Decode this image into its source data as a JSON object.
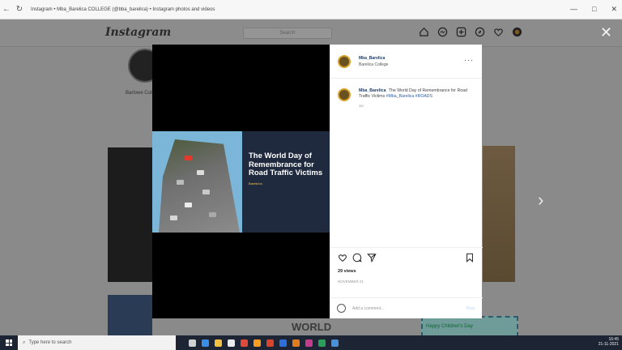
{
  "browser": {
    "title": "Instagram • Mba_Barelica COLLEGE (@bba_barelica) • Instagram photos and videos",
    "back_icon": "back-arrow-icon",
    "reload_icon": "reload-icon",
    "window_controls": [
      "—",
      "□",
      "✕"
    ]
  },
  "instagram": {
    "logo_text": "Instagram",
    "search_placeholder": "Search",
    "nav_icons": [
      "home-icon",
      "messenger-icon",
      "new-post-icon",
      "explore-icon",
      "heart-icon",
      "profile-avatar-icon"
    ],
    "close_label": "✕",
    "next_label": "›"
  },
  "background": {
    "profile_name": "Barlowe College",
    "bottom_text": "WORLD",
    "kids_banner": "Happy Children's Day"
  },
  "post": {
    "image_headline": "The World Day of Remembrance for Road Traffic Victims",
    "image_small": "Barelicha",
    "author": {
      "username": "Mba_Barelica",
      "location": "Barelica College"
    },
    "caption": {
      "username": "Mba_Barelica",
      "text": "The World Day of Remembrance for Road Traffic Victims",
      "tags": "#Mba_Barelica #ROADS",
      "age": "1w"
    },
    "views": "29 views",
    "date": "NOVEMBER 21",
    "add_comment_placeholder": "Add a comment...",
    "post_button": "Post"
  },
  "taskbar": {
    "search_placeholder": "Type here to search",
    "time": "16:45",
    "date": "21-11-2021"
  },
  "colors": {
    "modal_caption_bg": "#1f2a3e",
    "link_blue": "#2b5c9e",
    "taskbar_bg": "#1d2433"
  }
}
